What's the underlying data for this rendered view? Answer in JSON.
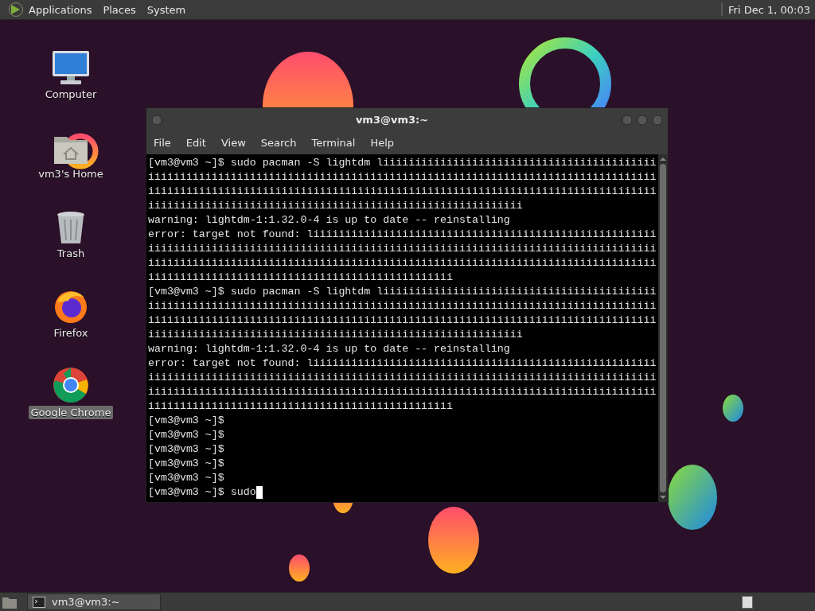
{
  "top_panel": {
    "menus": [
      "Applications",
      "Places",
      "System"
    ],
    "clock": "Fri Dec 1, 00:03"
  },
  "desktop_icons": [
    {
      "kind": "computer",
      "label": "Computer",
      "selected": false
    },
    {
      "kind": "home",
      "label": "vm3's Home",
      "selected": false
    },
    {
      "kind": "trash",
      "label": "Trash",
      "selected": false
    },
    {
      "kind": "firefox",
      "label": "Firefox",
      "selected": false
    },
    {
      "kind": "chrome",
      "label": "Google Chrome",
      "selected": true
    }
  ],
  "terminal_window": {
    "title": "vm3@vm3:~",
    "menu": [
      "File",
      "Edit",
      "View",
      "Search",
      "Terminal",
      "Help"
    ],
    "lines": [
      "[vm3@vm3 ~]$ sudo pacman -S lightdm liiiiiiiiiiiiiiiiiiiiiiiiiiiiiiiiiiiiiiiiiii",
      "iiiiiiiiiiiiiiiiiiiiiiiiiiiiiiiiiiiiiiiiiiiiiiiiiiiiiiiiiiiiiiiiiiiiiiiiiiiiiiii",
      "iiiiiiiiiiiiiiiiiiiiiiiiiiiiiiiiiiiiiiiiiiiiiiiiiiiiiiiiiiiiiiiiiiiiiiiiiiiiiiii",
      "iiiiiiiiiiiiiiiiiiiiiiiiiiiiiiiiiiiiiiiiiiiiiiiiiiiiiiiiiii",
      "warning: lightdm-1:1.32.0-4 is up to date -- reinstalling",
      "error: target not found: liiiiiiiiiiiiiiiiiiiiiiiiiiiiiiiiiiiiiiiiiiiiiiiiiiiiii",
      "iiiiiiiiiiiiiiiiiiiiiiiiiiiiiiiiiiiiiiiiiiiiiiiiiiiiiiiiiiiiiiiiiiiiiiiiiiiiiiii",
      "iiiiiiiiiiiiiiiiiiiiiiiiiiiiiiiiiiiiiiiiiiiiiiiiiiiiiiiiiiiiiiiiiiiiiiiiiiiiiiii",
      "iiiiiiiiiiiiiiiiiiiiiiiiiiiiiiiiiiiiiiiiiiiiiiii",
      "[vm3@vm3 ~]$ sudo pacman -S lightdm liiiiiiiiiiiiiiiiiiiiiiiiiiiiiiiiiiiiiiiiiii",
      "iiiiiiiiiiiiiiiiiiiiiiiiiiiiiiiiiiiiiiiiiiiiiiiiiiiiiiiiiiiiiiiiiiiiiiiiiiiiiiii",
      "iiiiiiiiiiiiiiiiiiiiiiiiiiiiiiiiiiiiiiiiiiiiiiiiiiiiiiiiiiiiiiiiiiiiiiiiiiiiiiii",
      "iiiiiiiiiiiiiiiiiiiiiiiiiiiiiiiiiiiiiiiiiiiiiiiiiiiiiiiiiii",
      "warning: lightdm-1:1.32.0-4 is up to date -- reinstalling",
      "error: target not found: liiiiiiiiiiiiiiiiiiiiiiiiiiiiiiiiiiiiiiiiiiiiiiiiiiiiii",
      "iiiiiiiiiiiiiiiiiiiiiiiiiiiiiiiiiiiiiiiiiiiiiiiiiiiiiiiiiiiiiiiiiiiiiiiiiiiiiiii",
      "iiiiiiiiiiiiiiiiiiiiiiiiiiiiiiiiiiiiiiiiiiiiiiiiiiiiiiiiiiiiiiiiiiiiiiiiiiiiiiii",
      "iiiiiiiiiiiiiiiiiiiiiiiiiiiiiiiiiiiiiiiiiiiiiiii",
      "[vm3@vm3 ~]$",
      "[vm3@vm3 ~]$",
      "[vm3@vm3 ~]$",
      "[vm3@vm3 ~]$",
      "[vm3@vm3 ~]$",
      "[vm3@vm3 ~]$ sudo"
    ],
    "cursor": true
  },
  "taskbar": {
    "tasks": [
      {
        "label": "vm3@vm3:~",
        "selected": false
      }
    ]
  }
}
